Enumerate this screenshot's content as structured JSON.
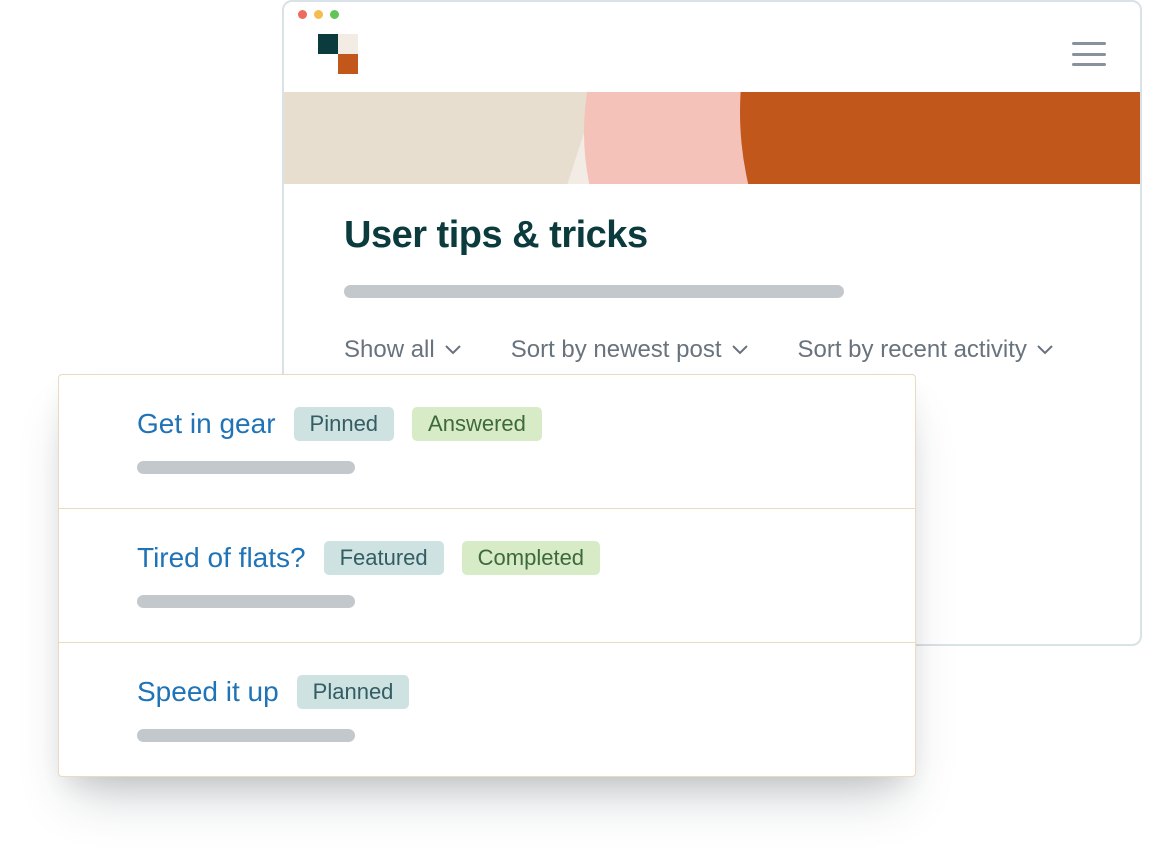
{
  "page": {
    "title": "User tips & tricks"
  },
  "filters": {
    "show": "Show all",
    "sort1": "Sort by newest post",
    "sort2": "Sort by recent activity"
  },
  "badges": {
    "pinned": "Pinned",
    "answered": "Answered",
    "featured": "Featured",
    "completed": "Completed",
    "planned": "Planned"
  },
  "posts": [
    {
      "title": "Get in gear",
      "b1": "pinned",
      "b2": "answered"
    },
    {
      "title": "Tired of flats?",
      "b1": "featured",
      "b2": "completed"
    },
    {
      "title": "Speed it up",
      "b1": "planned",
      "b2": null
    }
  ]
}
